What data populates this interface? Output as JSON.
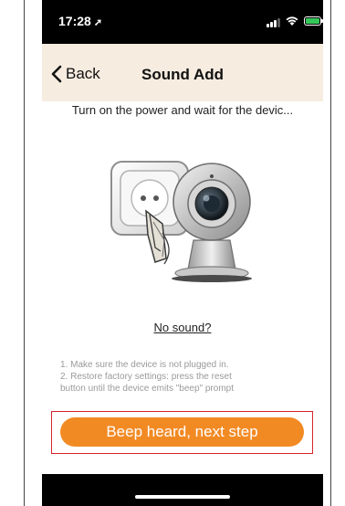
{
  "status_bar": {
    "time": "17:28",
    "location_glyph": "➚"
  },
  "navbar": {
    "back_label": "Back",
    "title": "Sound Add"
  },
  "content": {
    "instruction": "Turn on the power and wait for the devic...",
    "illustration": "power-outlet-and-camera-illustration",
    "no_sound_link": "No sound?",
    "tips": [
      "1. Make sure the device is not plugged in.",
      "2. Restore factory settings: press the reset",
      "button until the device emits \"beep\" prompt"
    ],
    "next_button": "Beep heard, next step"
  },
  "colors": {
    "navbar_bg": "#f6ece0",
    "button": "#f28a24",
    "highlight": "#d8232a",
    "battery": "#35c759"
  }
}
